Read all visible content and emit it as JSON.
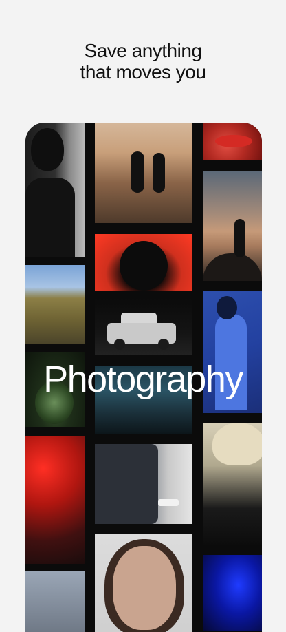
{
  "header": {
    "line1": "Save anything",
    "line2": "that moves you"
  },
  "overlay": {
    "category_label": "Photography"
  },
  "gallery": {
    "tiles": [
      {
        "name": "portrait-man-in-dark-jacket"
      },
      {
        "name": "hillside-house-landscape"
      },
      {
        "name": "green-splash-glass"
      },
      {
        "name": "red-lit-figure"
      },
      {
        "name": "beach-runners-silhouette"
      },
      {
        "name": "headphones-red-background"
      },
      {
        "name": "white-suv-at-night"
      },
      {
        "name": "ocean-waves"
      },
      {
        "name": "car-rear-light"
      },
      {
        "name": "woman-portrait"
      },
      {
        "name": "red-lips-closeup"
      },
      {
        "name": "golfer-sunset"
      },
      {
        "name": "figure-blue-jacket"
      },
      {
        "name": "blonde-person-back"
      },
      {
        "name": "blue-light-figure"
      }
    ]
  },
  "colors": {
    "background": "#f3f3f3",
    "card": "#0b0b0b",
    "text_dark": "#111111",
    "text_light": "#ffffff"
  }
}
